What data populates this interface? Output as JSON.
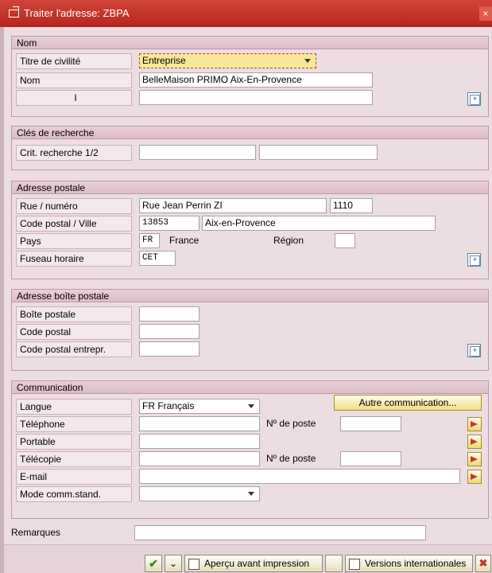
{
  "window": {
    "title": "Traiter l'adresse:  ZBPA",
    "close_glyph": "×"
  },
  "nom": {
    "heading": "Nom",
    "titre_label": "Titre de civilité",
    "titre_value": "Entreprise",
    "nom_label": "Nom",
    "nom_value": "BelleMaison PRIMO Aix-En-Provence",
    "cursor_glyph": "I",
    "nom2_value": ""
  },
  "recherche": {
    "heading": "Clés de recherche",
    "crit_label": "Crit. recherche 1/2",
    "crit1": "",
    "crit2": ""
  },
  "adresse": {
    "heading": "Adresse postale",
    "rue_label": "Rue / numéro",
    "rue_value": "Rue Jean Perrin ZI",
    "numero_value": "1110",
    "cp_label": "Code postal / Ville",
    "cp_value": "13853",
    "ville_value": "Aix-en-Provence",
    "pays_label": "Pays",
    "pays_code": "FR",
    "pays_name": "France",
    "region_label": "Région",
    "region_value": "",
    "fuseau_label": "Fuseau horaire",
    "fuseau_value": "CET"
  },
  "boite": {
    "heading": "Adresse boîte postale",
    "boite_label": "Boîte postale",
    "cp_label": "Code postal",
    "cpe_label": "Code postal entrepr."
  },
  "communication": {
    "heading": "Communication",
    "langue_label": "Langue",
    "langue_value": "FR Français",
    "autre_button": "Autre communication...",
    "tel_label": "Téléphone",
    "poste_label": "Nº de poste",
    "portable_label": "Portable",
    "telecopie_label": "Télécopie",
    "email_label": "E-mail",
    "mode_label": "Mode comm.stand."
  },
  "remarques": {
    "label": "Remarques",
    "value": ""
  },
  "toolbar": {
    "print_preview_label": "Aperçu avant impression",
    "intl_versions_label": "Versions internationales"
  },
  "colors": {
    "titlebar": "#c0392b",
    "background": "#ecdde1",
    "button_yellow": "#f4de86"
  }
}
